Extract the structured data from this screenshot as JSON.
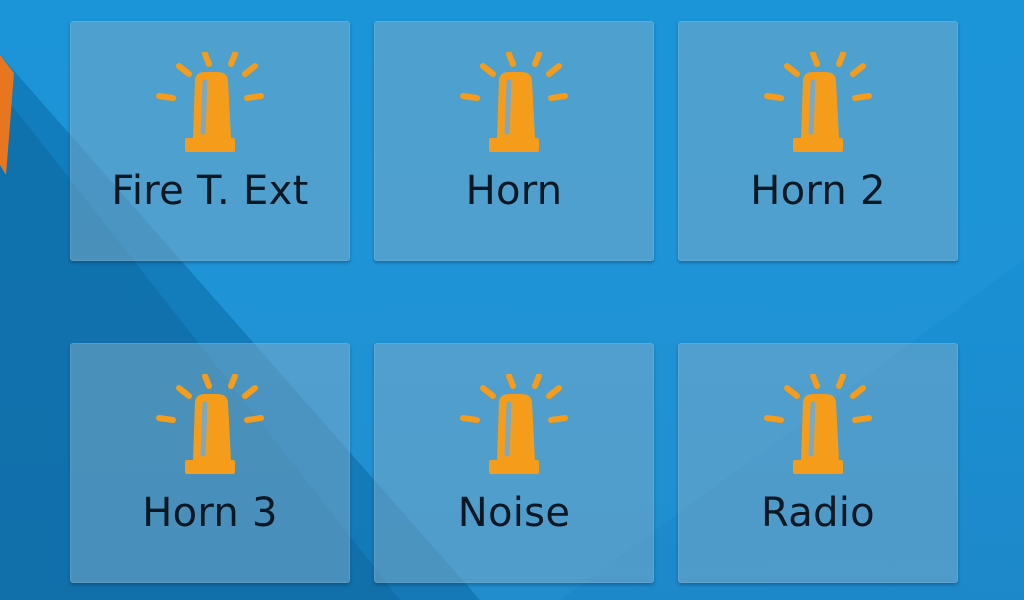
{
  "colors": {
    "wallpaper": "#1592d6",
    "wallpaper_shadow": "#0f6ea8",
    "tile_background": "#78aac8",
    "icon_accent": "#f59c1a",
    "label_text": "#0b1722",
    "wallpaper_edge_accent": "#e8761f"
  },
  "tiles": [
    {
      "label": "Fire T. Ext",
      "icon": "siren-icon"
    },
    {
      "label": "Horn",
      "icon": "siren-icon"
    },
    {
      "label": "Horn 2",
      "icon": "siren-icon"
    },
    {
      "label": "Horn 3",
      "icon": "siren-icon"
    },
    {
      "label": "Noise",
      "icon": "siren-icon"
    },
    {
      "label": "Radio",
      "icon": "siren-icon"
    }
  ]
}
